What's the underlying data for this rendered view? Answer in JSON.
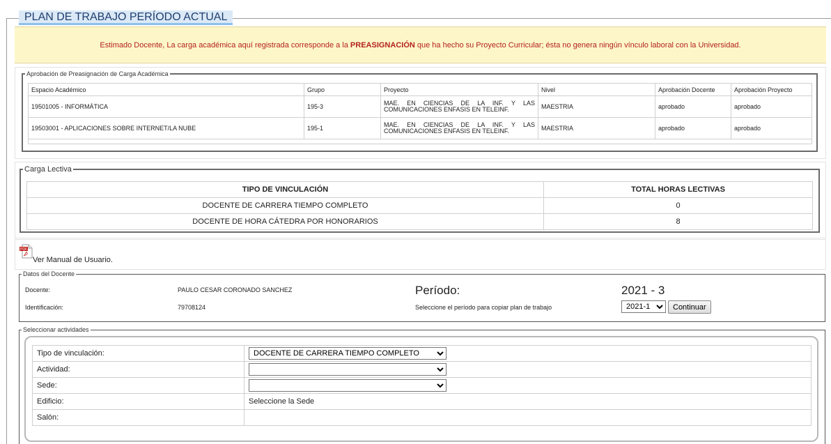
{
  "page": {
    "title": "PLAN DE TRABAJO PERÍODO ACTUAL",
    "notice_pre": "Estimado Docente, La carga académica aquí registrada corresponde a la ",
    "notice_bold": "PREASIGNACIÓN",
    "notice_post": " que ha hecho su Proyecto Curricular; ésta no genera ningún vínculo laboral con la Universidad."
  },
  "approval": {
    "legend": "Aprobación de Preasignación de Carga Académica",
    "headers": [
      "Espacio Académico",
      "Grupo",
      "Proyecto",
      "Nivel",
      "Aprobación Docente",
      "Aprobación Proyecto"
    ],
    "rows": [
      [
        "19501005 - INFORMÁTICA",
        "195-3",
        "MAE. EN CIENCIAS DE LA INF. Y LAS COMUNICACIONES ENFASIS EN TELEINF.",
        "MAESTRIA",
        "aprobado",
        "aprobado"
      ],
      [
        "19503001 - APLICACIONES SOBRE INTERNET/LA NUBE",
        "195-1",
        "MAE. EN CIENCIAS DE LA INF. Y LAS COMUNICACIONES ENFASIS EN TELEINF.",
        "MAESTRIA",
        "aprobado",
        "aprobado"
      ]
    ]
  },
  "lectiva": {
    "legend": "Carga Lectiva",
    "headers": [
      "TIPO DE VINCULACIÓN",
      "TOTAL HORAS LECTIVAS"
    ],
    "rows": [
      [
        "DOCENTE DE CARRERA TIEMPO COMPLETO",
        "0"
      ],
      [
        "DOCENTE DE HORA CÁTEDRA POR HONORARIOS",
        "8"
      ]
    ]
  },
  "manual": {
    "label": "Ver Manual de Usuario.",
    "icon": "pdf-icon"
  },
  "docente": {
    "legend": "Datos del Docente",
    "docente_label": "Docente:",
    "docente_value": "PAULO CESAR CORONADO SANCHEZ",
    "id_label": "Identificación:",
    "id_value": "79708124",
    "periodo_label": "Período:",
    "periodo_value": "2021 - 3",
    "copy_label": "Seleccione el período para copiar plan de trabajo",
    "copy_selected": "2021-1",
    "continue_label": "Continuar"
  },
  "actividades": {
    "legend": "Seleccionar actividades",
    "tipo_label": "Tipo de vinculación:",
    "tipo_selected": "DOCENTE DE CARRERA TIEMPO COMPLETO",
    "actividad_label": "Actividad:",
    "actividad_selected": "",
    "sede_label": "Sede:",
    "sede_selected": "",
    "edificio_label": "Edificio:",
    "edificio_value": "Seleccione la Sede",
    "salon_label": "Salón:"
  }
}
